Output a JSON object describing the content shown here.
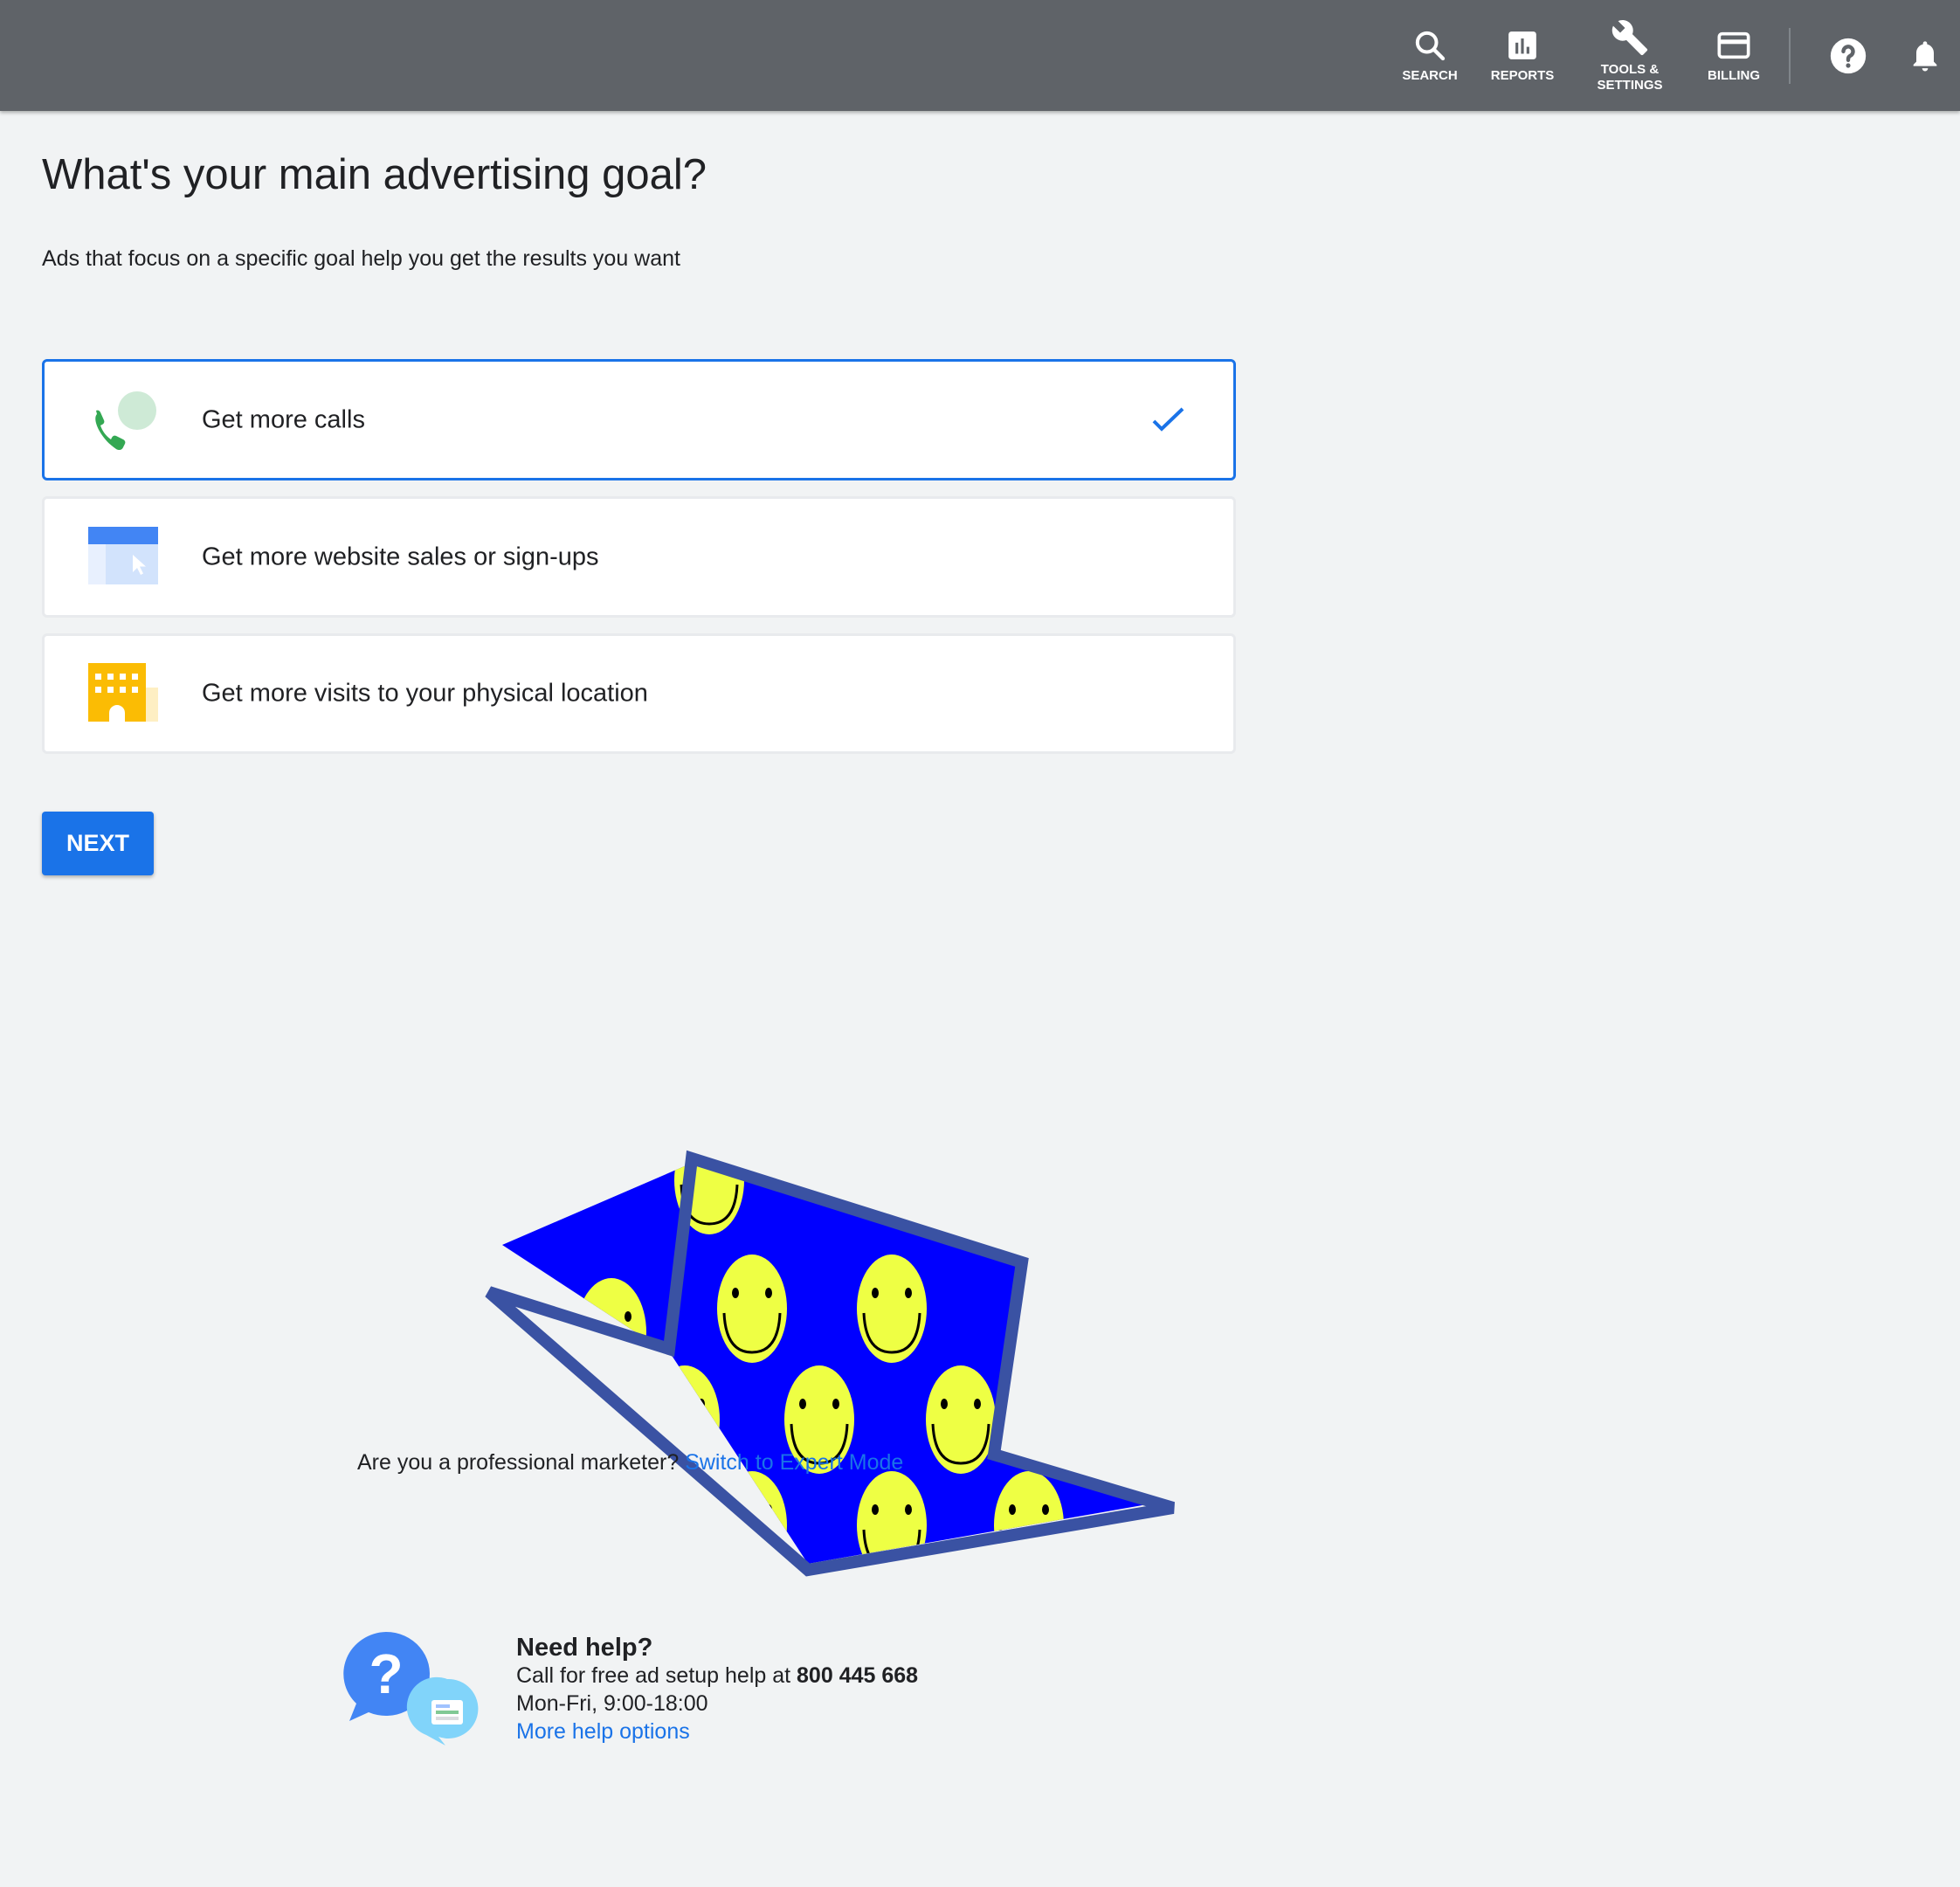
{
  "topbar": {
    "items": [
      {
        "label": "SEARCH",
        "icon": "search-icon"
      },
      {
        "label": "REPORTS",
        "icon": "reports-icon"
      },
      {
        "label": "TOOLS &",
        "label2": "SETTINGS",
        "icon": "wrench-icon"
      },
      {
        "label": "BILLING",
        "icon": "credit-card-icon"
      }
    ],
    "help_icon": "help-icon",
    "notifications_icon": "bell-icon"
  },
  "page": {
    "title": "What's your main advertising goal?",
    "subtitle": "Ads that focus on a specific goal help you get the results you want"
  },
  "goals": [
    {
      "label": "Get more calls",
      "icon": "phone-chat-icon",
      "selected": true
    },
    {
      "label": "Get more website sales or sign-ups",
      "icon": "website-cursor-icon",
      "selected": false
    },
    {
      "label": "Get more visits to your physical location",
      "icon": "building-icon",
      "selected": false
    }
  ],
  "next_label": "NEXT",
  "expert": {
    "question": "Are you a professional marketer?",
    "link": "Switch to Expert Mode"
  },
  "help": {
    "heading": "Need help?",
    "call_text": "Call for free ad setup help at",
    "phone": "800 445 668",
    "hours": "Mon-Fri, 9:00-18:00",
    "more_link": "More help options"
  },
  "colors": {
    "accent": "#1a73e8",
    "topbar": "#5f6368",
    "background": "#f1f3f4",
    "illustration_fill": "#0000ff",
    "illustration_border": "#3a52a3",
    "smiley": "#eeff44"
  }
}
